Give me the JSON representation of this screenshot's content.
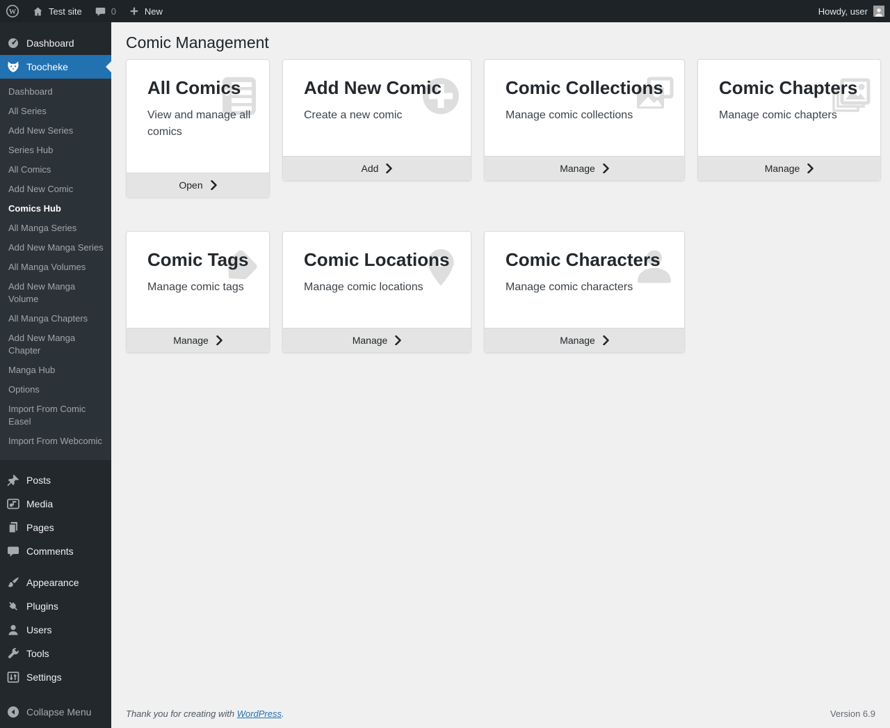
{
  "admin_bar": {
    "site_name": "Test site",
    "comments_count": "0",
    "new_label": "New",
    "howdy_text": "Howdy, user"
  },
  "sidebar": {
    "dashboard_label": "Dashboard",
    "plugin_label": "Toocheke",
    "submenu_items": [
      "Dashboard",
      "All Series",
      "Add New Series",
      "Series Hub",
      "All Comics",
      "Add New Comic",
      "Comics Hub",
      "All Manga Series",
      "Add New Manga Series",
      "All Manga Volumes",
      "Add New Manga Volume",
      "All Manga Chapters",
      "Add New Manga Chapter",
      "Manga Hub",
      "Options",
      "Import From Comic Easel",
      "Import From Webcomic"
    ],
    "submenu_current": "Comics Hub",
    "bottom_items": [
      {
        "label": "Posts",
        "icon": "pin-icon",
        "section_start": false
      },
      {
        "label": "Media",
        "icon": "media-icon",
        "section_start": false
      },
      {
        "label": "Pages",
        "icon": "pages-icon",
        "section_start": false
      },
      {
        "label": "Comments",
        "icon": "comment-icon",
        "section_start": false
      },
      {
        "label": "Appearance",
        "icon": "brush-icon",
        "section_start": true
      },
      {
        "label": "Plugins",
        "icon": "plug-icon",
        "section_start": false
      },
      {
        "label": "Users",
        "icon": "user-icon",
        "section_start": false
      },
      {
        "label": "Tools",
        "icon": "wrench-icon",
        "section_start": false
      },
      {
        "label": "Settings",
        "icon": "settings-icon",
        "section_start": false
      }
    ],
    "collapse_label": "Collapse Menu"
  },
  "main": {
    "page_title": "Comic Management",
    "cards": [
      {
        "title": "All Comics",
        "subtitle": "View and manage all comics",
        "action": "Open",
        "icon": "list-alt-icon"
      },
      {
        "title": "Add New Comic",
        "subtitle": "Create a new comic",
        "action": "Add",
        "icon": "add-circle-icon"
      },
      {
        "title": "Comic Collections",
        "subtitle": "Manage comic collections",
        "action": "Manage",
        "icon": "collections-icon"
      },
      {
        "title": "Comic Chapters",
        "subtitle": "Manage comic chapters",
        "action": "Manage",
        "icon": "stacked-photos-icon"
      },
      {
        "title": "Comic Tags",
        "subtitle": "Manage comic tags",
        "action": "Manage",
        "icon": "tag-icon"
      },
      {
        "title": "Comic Locations",
        "subtitle": "Manage comic locations",
        "action": "Manage",
        "icon": "location-pin-icon"
      },
      {
        "title": "Comic Characters",
        "subtitle": "Manage comic characters",
        "action": "Manage",
        "icon": "person-icon"
      }
    ]
  },
  "footer": {
    "thanks_prefix": "Thank you for creating with ",
    "wordpress_link_label": "WordPress",
    "thanks_suffix": ".",
    "version_text": "Version 6.9"
  },
  "colors": {
    "accent_blue": "#2271b1",
    "admin_bar_bg": "#1d2327",
    "sidebar_bg": "#23282d",
    "submenu_bg": "#2c3338",
    "content_bg": "#f0f0f1",
    "card_icon_grey": "#dedede"
  }
}
